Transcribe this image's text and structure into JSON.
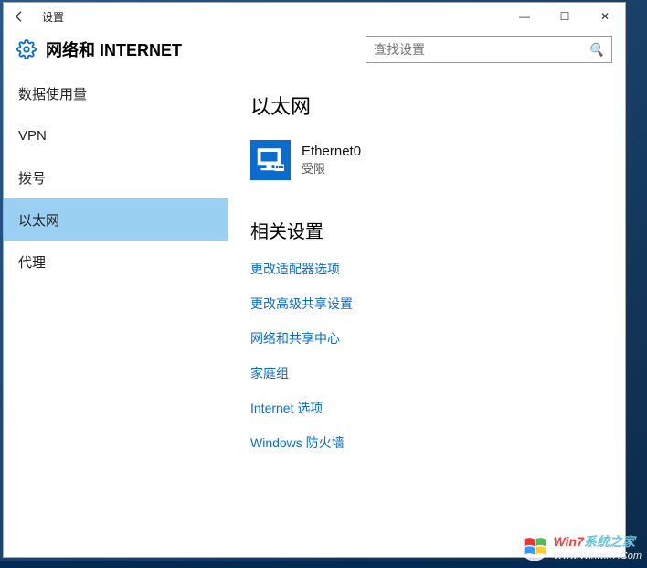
{
  "window": {
    "title": "设置",
    "min": "—",
    "max": "☐",
    "close": "✕"
  },
  "header": {
    "title": "网络和 INTERNET",
    "search_placeholder": "查找设置"
  },
  "sidebar": {
    "items": [
      {
        "label": "数据使用量",
        "selected": false
      },
      {
        "label": "VPN",
        "selected": false
      },
      {
        "label": "拨号",
        "selected": false
      },
      {
        "label": "以太网",
        "selected": true
      },
      {
        "label": "代理",
        "selected": false
      }
    ]
  },
  "content": {
    "page_title": "以太网",
    "adapter": {
      "name": "Ethernet0",
      "status": "受限"
    },
    "related_title": "相关设置",
    "related_links": [
      "更改适配器选项",
      "更改高级共享设置",
      "网络和共享中心",
      "家庭组",
      "Internet 选项",
      "Windows 防火墙"
    ]
  },
  "watermark": {
    "brand_prefix": "Win7",
    "brand_suffix": "系统之家",
    "url": "Www.Winwin7.Com"
  }
}
